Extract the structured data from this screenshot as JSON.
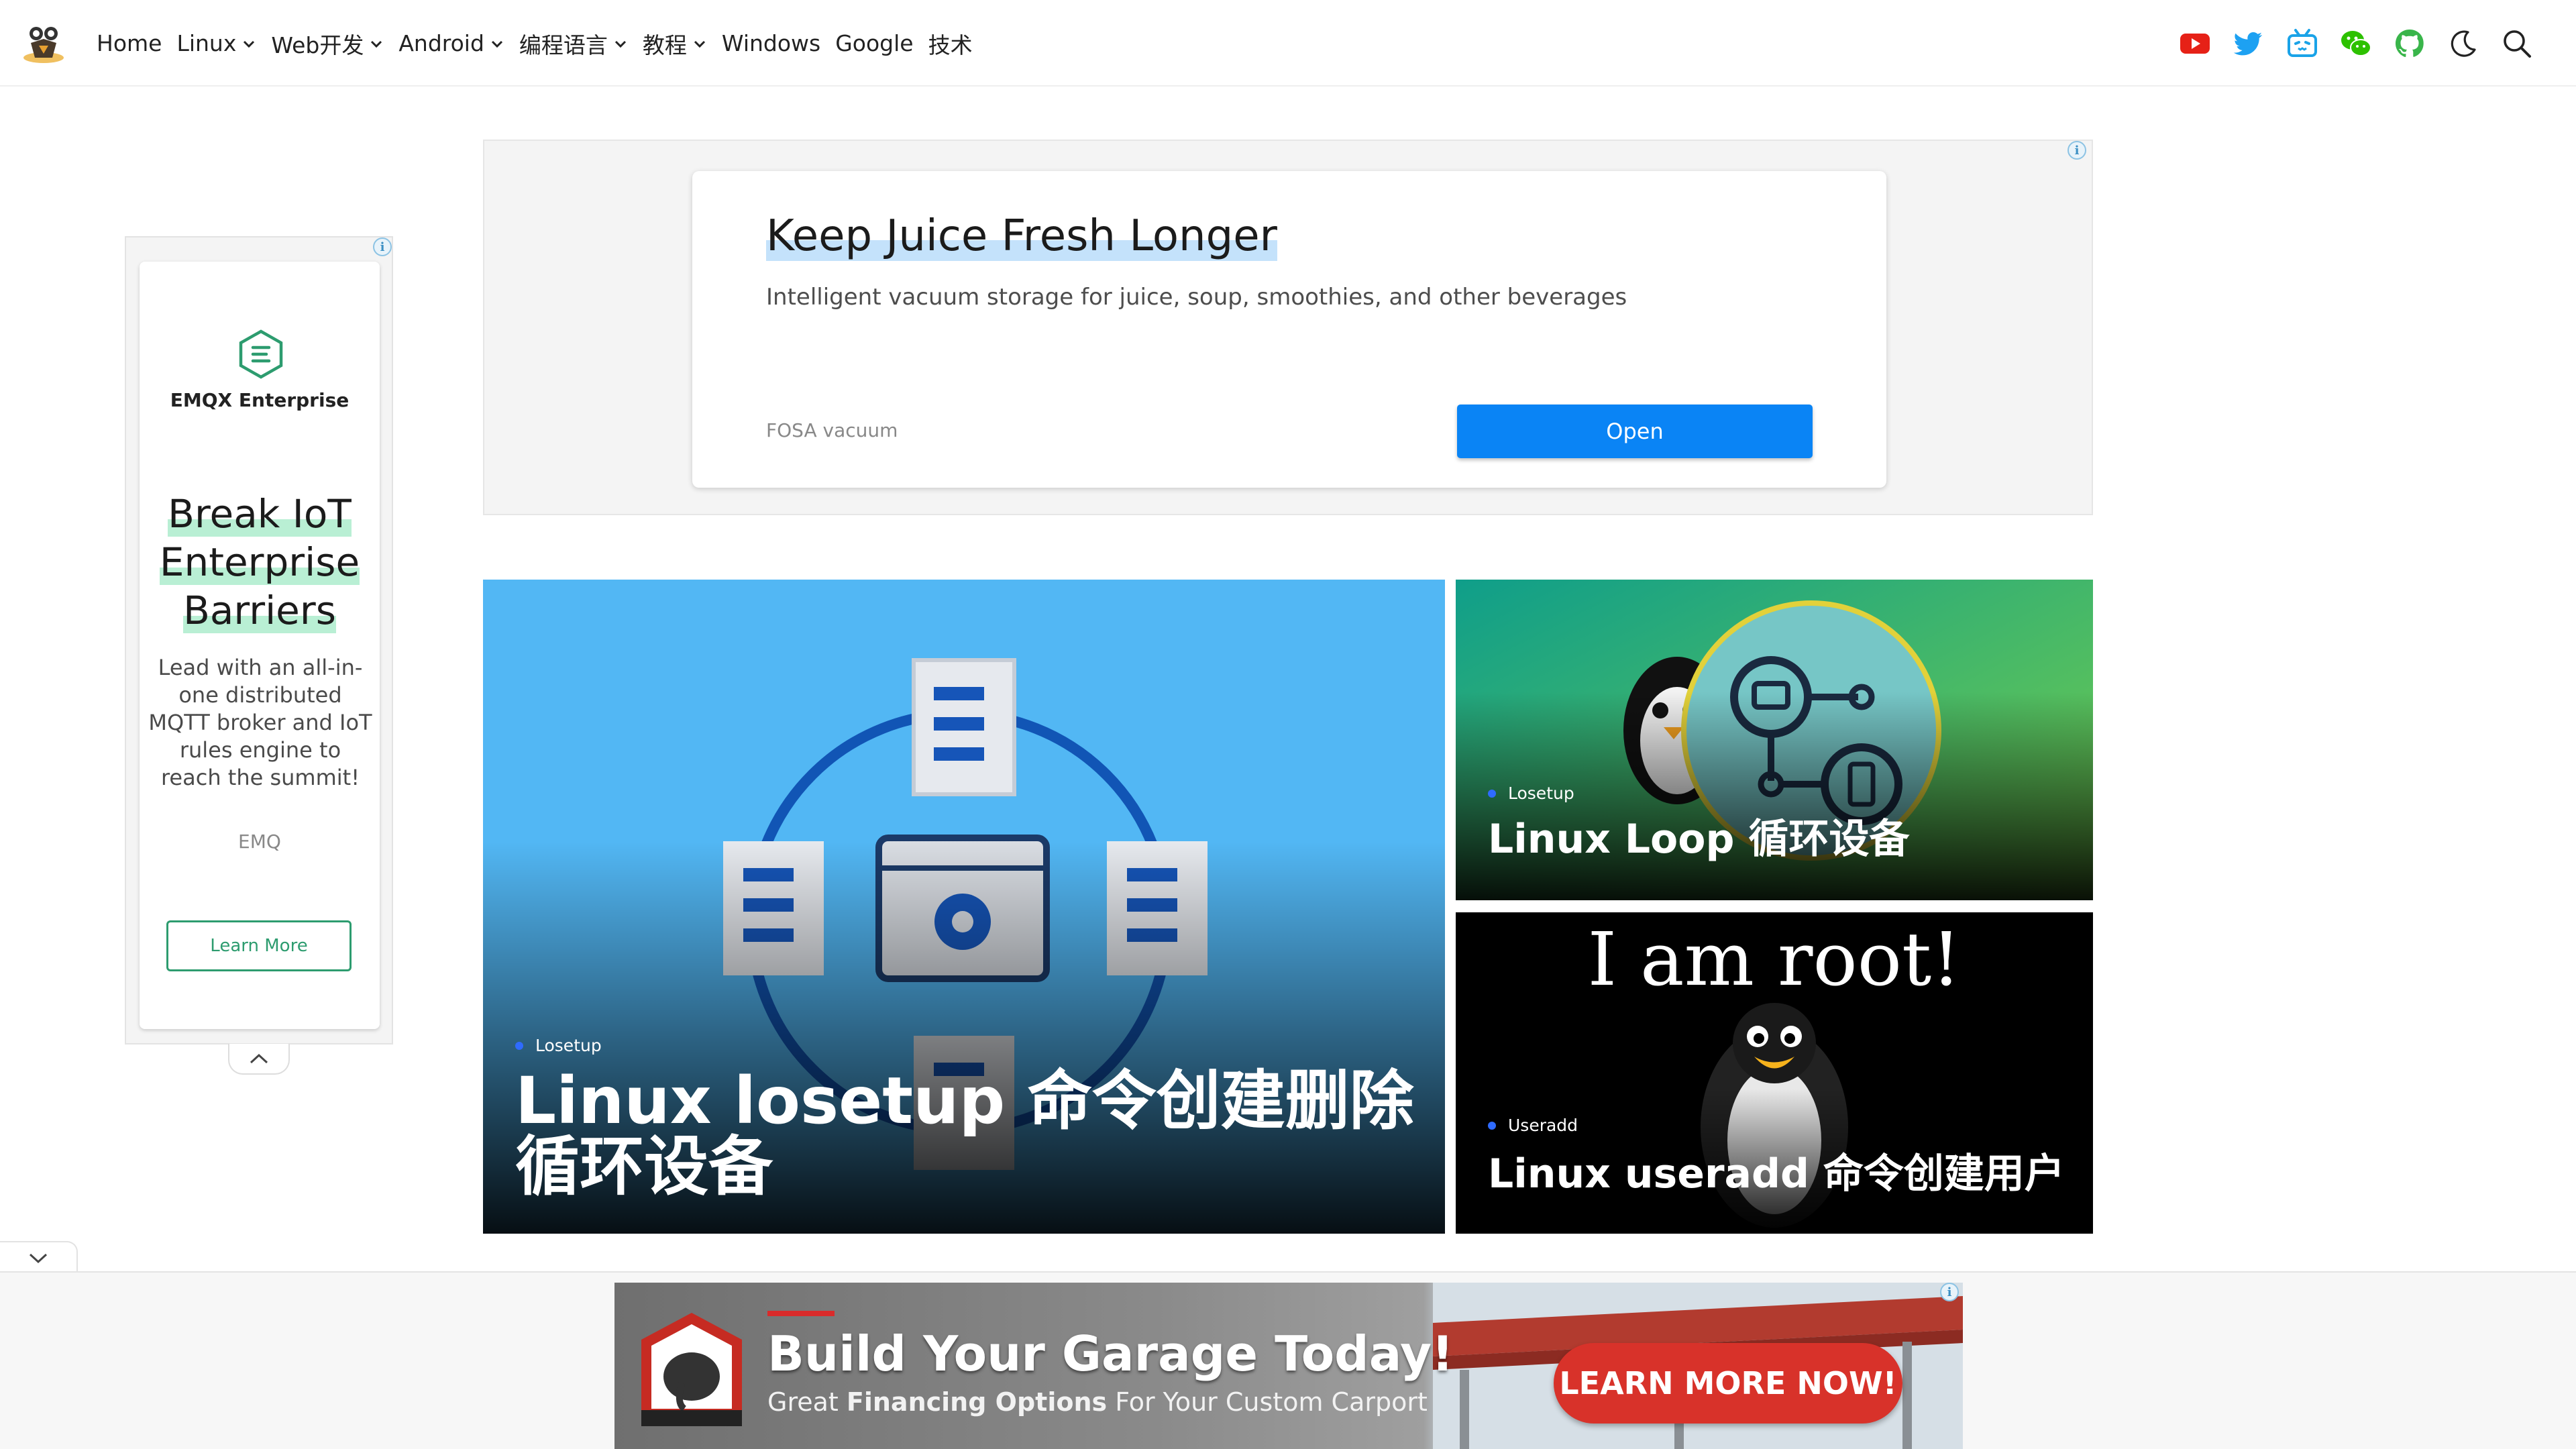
{
  "nav": {
    "items": [
      {
        "label": "Home",
        "dropdown": false
      },
      {
        "label": "Linux",
        "dropdown": true
      },
      {
        "label": "Web开发",
        "dropdown": true
      },
      {
        "label": "Android",
        "dropdown": true
      },
      {
        "label": "编程语言",
        "dropdown": true
      },
      {
        "label": "教程",
        "dropdown": true
      },
      {
        "label": "Windows",
        "dropdown": false
      },
      {
        "label": "Google",
        "dropdown": false
      },
      {
        "label": "技术",
        "dropdown": false
      }
    ],
    "icons": [
      "youtube-icon",
      "twitter-icon",
      "bilibili-icon",
      "wechat-icon",
      "github-icon",
      "dark-mode-icon",
      "search-icon"
    ]
  },
  "side_ad": {
    "brand": "EMQX Enterprise",
    "headline": [
      "Break IoT",
      "Enterprise",
      "Barriers"
    ],
    "body": "Lead with an all-in-one distributed MQTT broker and IoT rules engine to reach the summit!",
    "advertiser": "EMQ",
    "button": "Learn More",
    "accent": "#2d9c6f"
  },
  "top_ad": {
    "title": "Keep Juice Fresh Longer",
    "description": "Intelligent vacuum storage for juice, soup, smoothies, and other beverages",
    "advertiser": "FOSA vacuum",
    "button": "Open",
    "accent": "#0a84f5"
  },
  "posts": [
    {
      "category": "Losetup",
      "title": "Linux losetup 命令创建删除循环设备"
    },
    {
      "category": "Losetup",
      "title": "Linux Loop 循环设备"
    },
    {
      "category": "Useradd",
      "title": "Linux useradd 命令创建用户",
      "image_caption": "I am root!"
    }
  ],
  "bottom_ad": {
    "title": "Build Your Garage Today!",
    "subtitle_pre": "Great ",
    "subtitle_bold": "Financing Options",
    "subtitle_post": " For Your Custom Carport",
    "cta": "LEARN MORE NOW!"
  }
}
